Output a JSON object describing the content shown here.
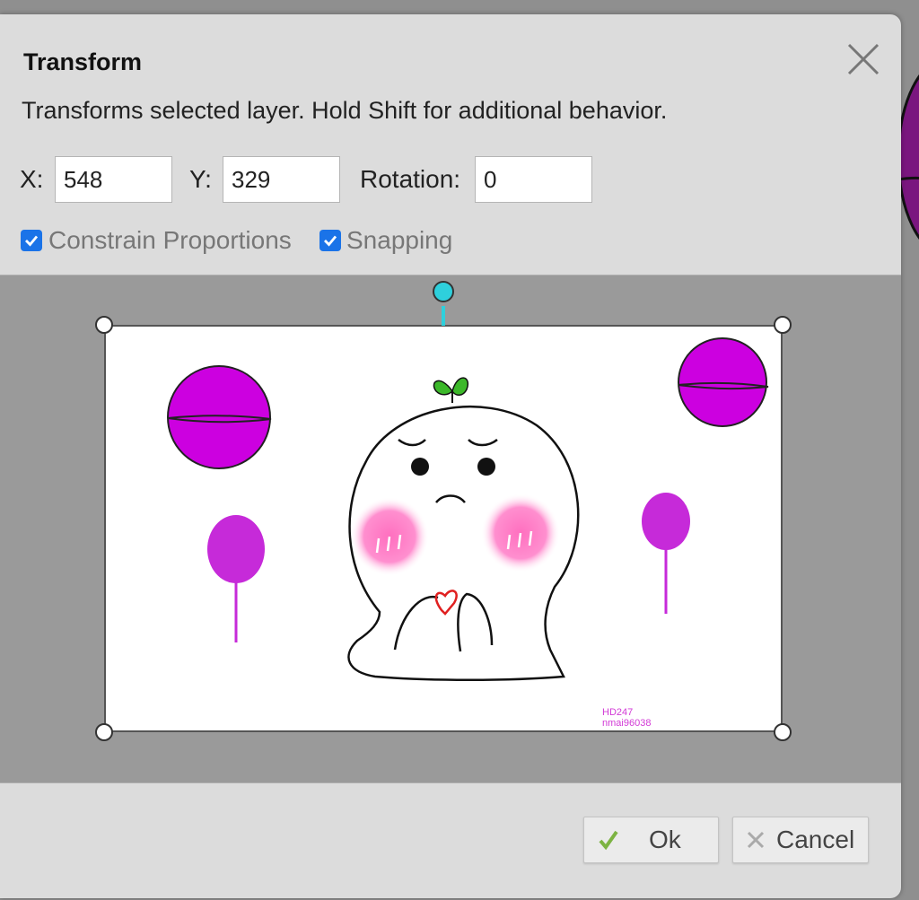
{
  "dialog": {
    "title": "Transform",
    "description": "Transforms selected layer. Hold Shift for additional behavior.",
    "x_label": "X:",
    "x_value": "548",
    "y_label": "Y:",
    "y_value": "329",
    "rotation_label": "Rotation:",
    "rotation_value": "0",
    "constrain_label": "Constrain Proportions",
    "constrain_checked": true,
    "snapping_label": "Snapping",
    "snapping_checked": true,
    "ok_label": "Ok",
    "cancel_label": "Cancel"
  },
  "preview": {
    "watermark_line1": "HD247",
    "watermark_line2": "nmai96038"
  },
  "colors": {
    "accent": "#1a73e8",
    "rotation_handle": "#2ed0dc",
    "ok_check": "#7cb342",
    "purple": "#cc00e0"
  },
  "icons": [
    "close-icon",
    "checkbox-check-icon",
    "ok-check-icon",
    "cancel-x-icon"
  ]
}
